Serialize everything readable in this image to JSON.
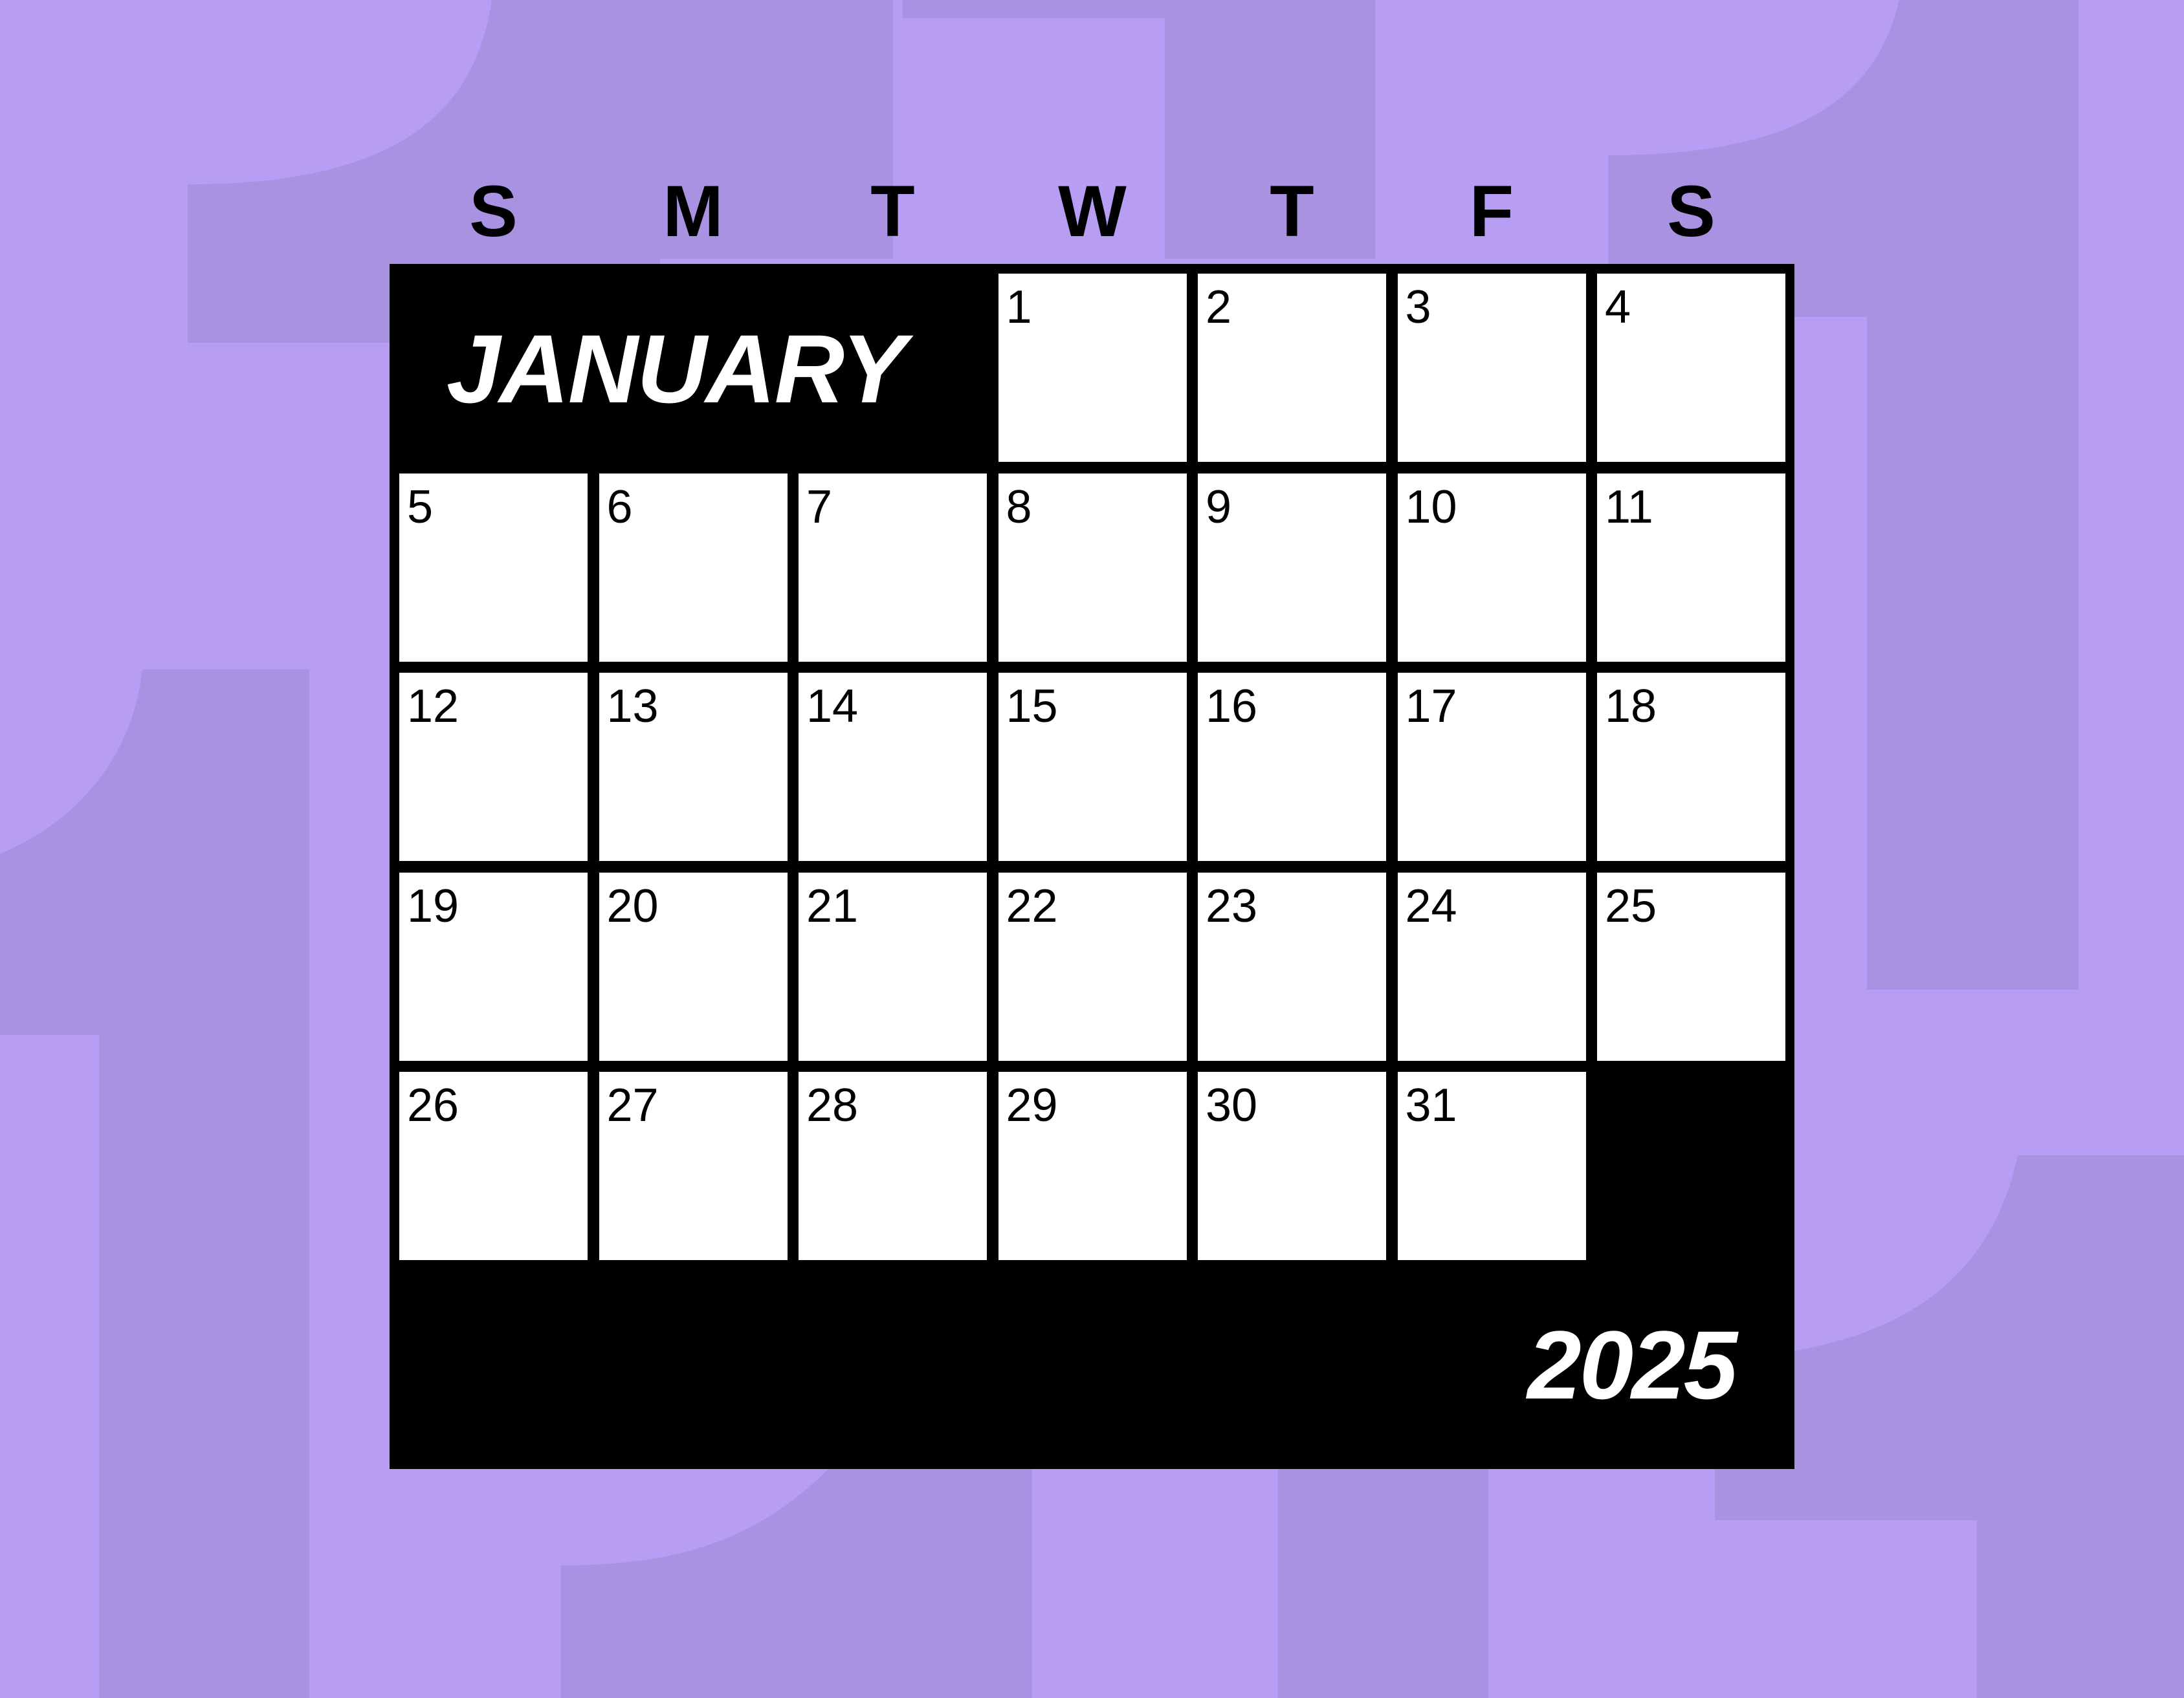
{
  "colors": {
    "background": "#b89df5",
    "background_shape": "#aa92e2",
    "frame": "#000000",
    "cell": "#ffffff",
    "text_dark": "#000000",
    "text_light": "#ffffff"
  },
  "calendar": {
    "month": "JANUARY",
    "year": "2025",
    "weekdays": [
      "S",
      "M",
      "T",
      "W",
      "T",
      "F",
      "S"
    ],
    "first_weekday_index": 3,
    "days": [
      "1",
      "2",
      "3",
      "4",
      "5",
      "6",
      "7",
      "8",
      "9",
      "10",
      "11",
      "12",
      "13",
      "14",
      "15",
      "16",
      "17",
      "18",
      "19",
      "20",
      "21",
      "22",
      "23",
      "24",
      "25",
      "26",
      "27",
      "28",
      "29",
      "30",
      "31"
    ]
  }
}
